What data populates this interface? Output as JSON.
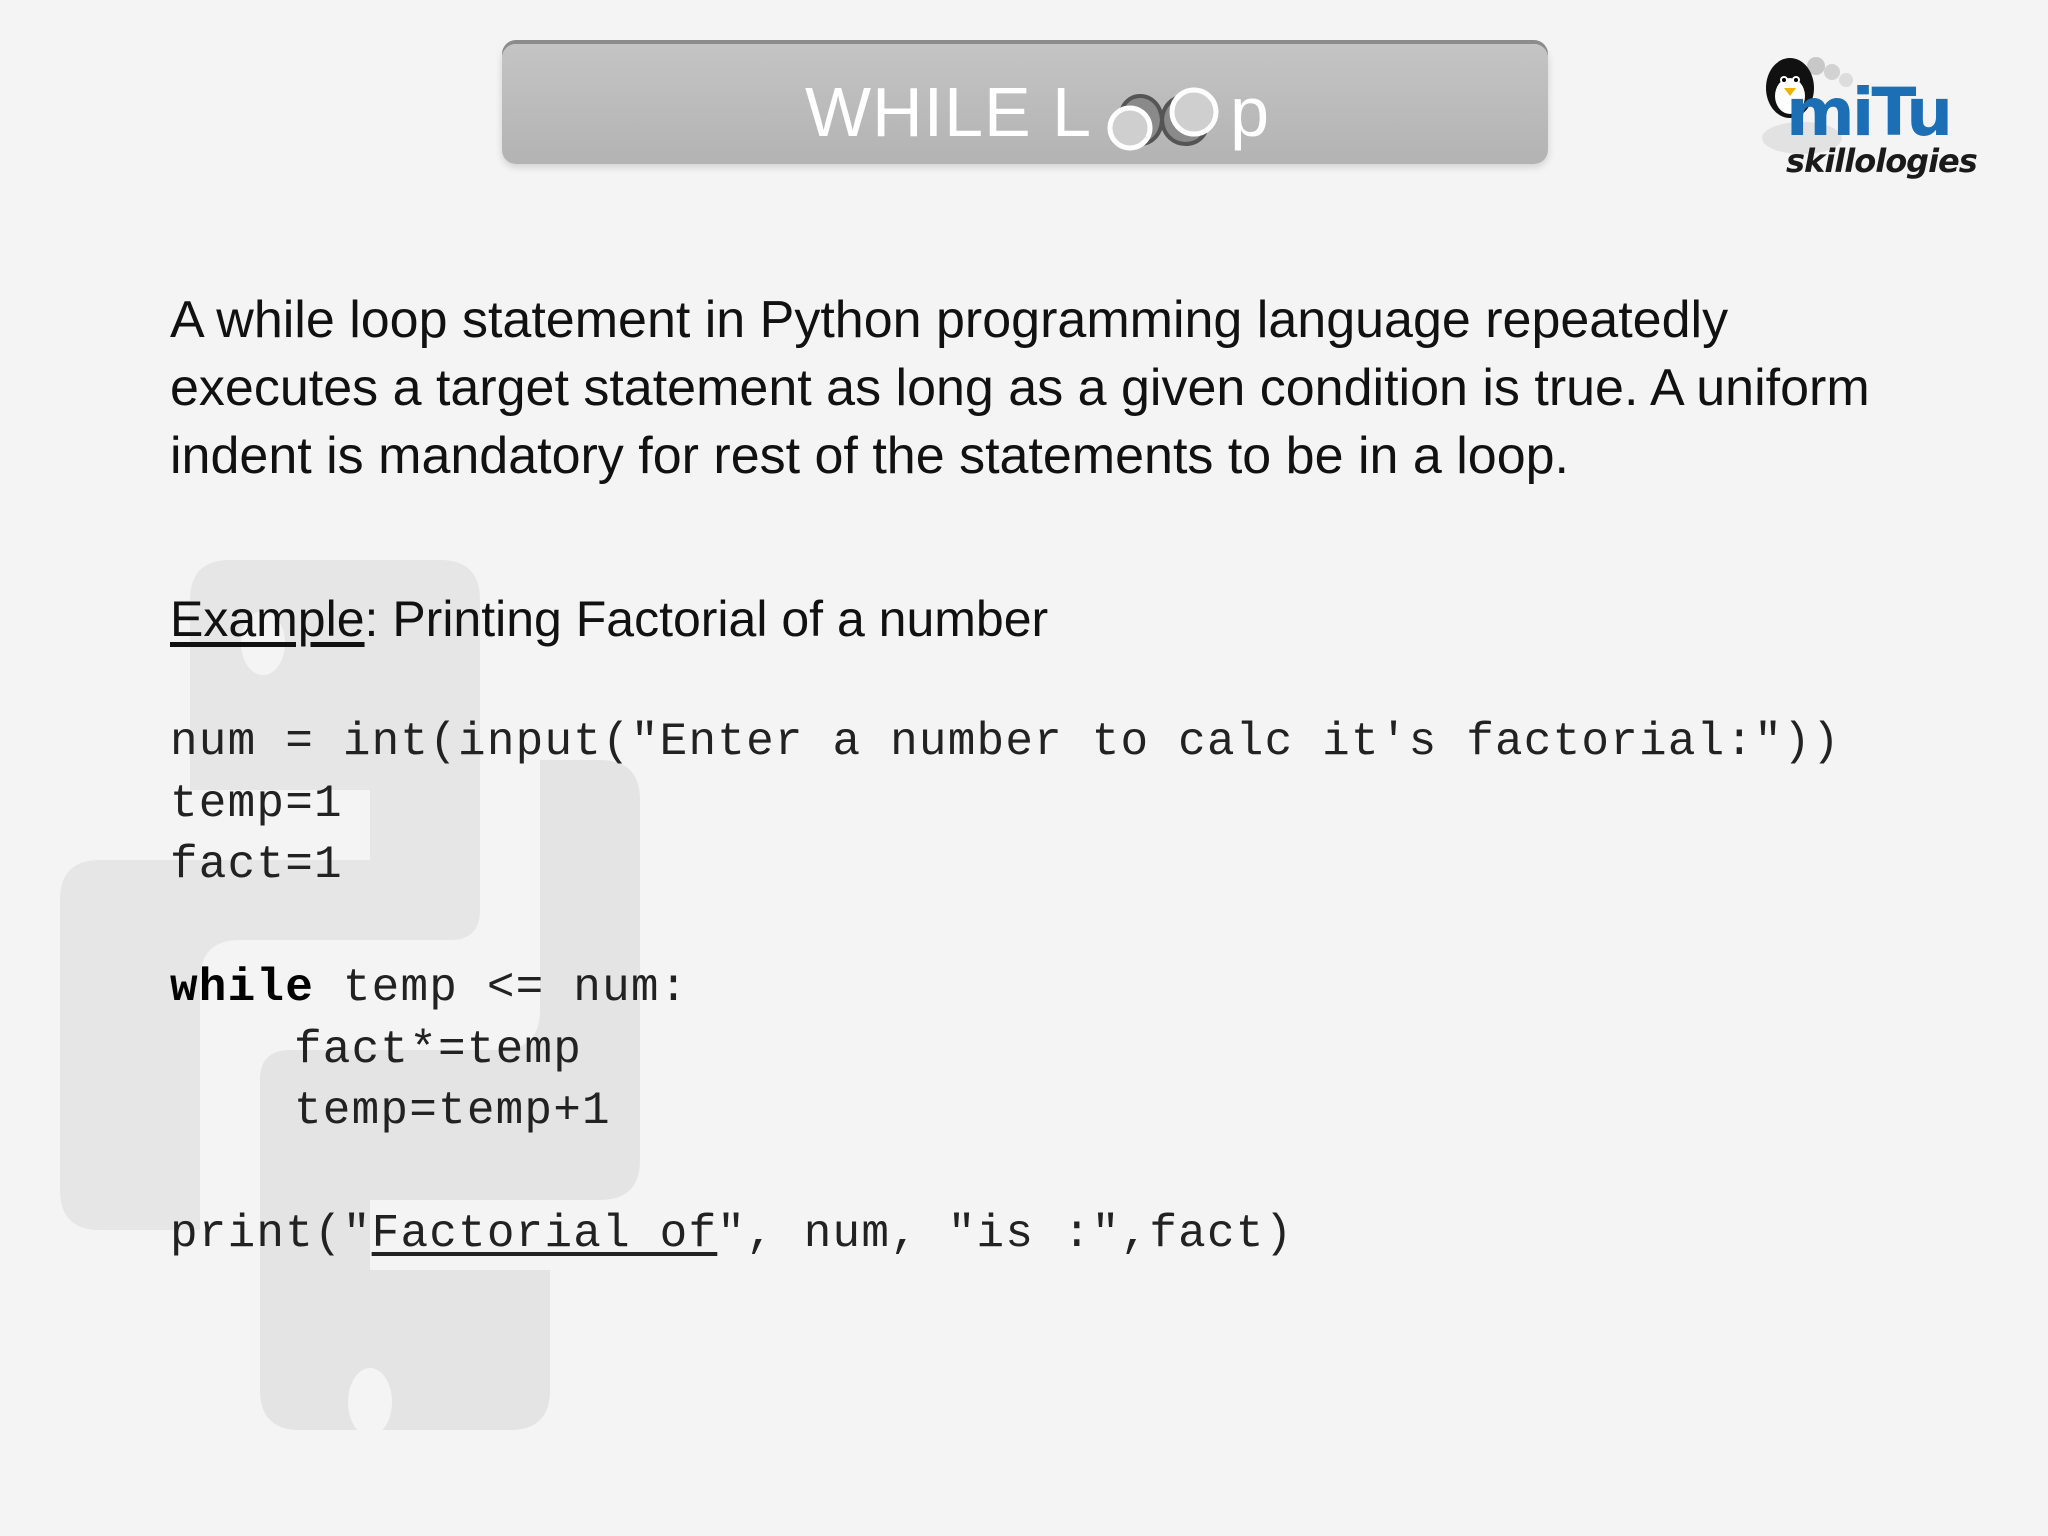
{
  "title": {
    "part1": "WHILE L",
    "part2": "p",
    "icon": "infinity-loop-icon"
  },
  "logo": {
    "main": "miTu",
    "sub": "skillologies",
    "icon": "penguin-icon"
  },
  "description": "A while loop statement in Python programming language repeatedly executes a target statement as long as a given condition is true. A uniform indent is mandatory for rest of the statements to be in a loop.",
  "example": {
    "label": "Example",
    "text": ": Printing Factorial of a number"
  },
  "code": {
    "line1": "num = int(input(\"Enter a number to calc it's factorial:\"))",
    "line2": "temp=1",
    "line3": "fact=1",
    "line5_kw": "while",
    "line5_rest": " temp <= num:",
    "line6": "fact*=temp",
    "line7": "temp=temp+1",
    "line9_a": "print(\"",
    "line9_u": "Factorial of",
    "line9_b": "\", num, \"is :\",fact)"
  },
  "watermark_icon": "python-logo-icon",
  "colors": {
    "background": "#f4f4f4",
    "banner": "#bdbdbd",
    "title_text": "#ffffff",
    "logo_blue": "#1d6fb5"
  }
}
